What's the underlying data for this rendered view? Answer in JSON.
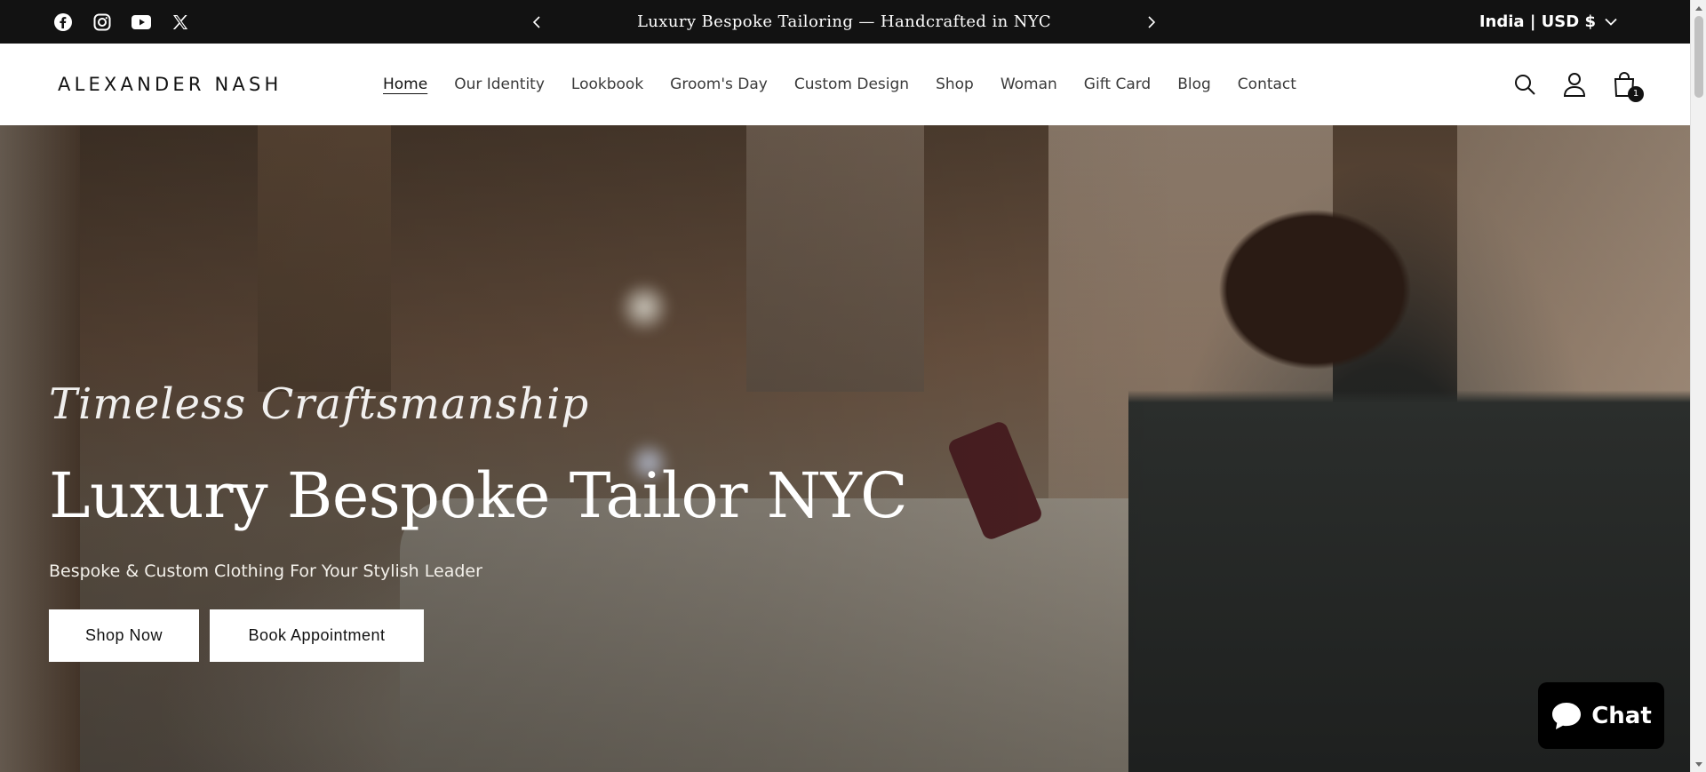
{
  "social": [
    {
      "name": "facebook-icon"
    },
    {
      "name": "instagram-icon"
    },
    {
      "name": "youtube-icon"
    },
    {
      "name": "x-twitter-icon"
    }
  ],
  "announcement": {
    "text": "Luxury Bespoke Tailoring — Handcrafted in NYC"
  },
  "locale": {
    "label": "India | USD $"
  },
  "header": {
    "logo": "ALEXANDER NASH",
    "nav": [
      {
        "label": "Home",
        "active": true
      },
      {
        "label": "Our Identity"
      },
      {
        "label": "Lookbook"
      },
      {
        "label": "Groom's Day"
      },
      {
        "label": "Custom Design"
      },
      {
        "label": "Shop"
      },
      {
        "label": "Woman"
      },
      {
        "label": "Gift Card"
      },
      {
        "label": "Blog"
      },
      {
        "label": "Contact"
      }
    ],
    "cart_count": "1"
  },
  "hero": {
    "tagline": "Timeless Craftsmanship",
    "title": "Luxury Bespoke Tailor NYC",
    "subtitle": "Bespoke & Custom Clothing For Your Stylish Leader",
    "buttons": {
      "shop": "Shop Now",
      "book": "Book Appointment"
    }
  },
  "chat": {
    "label": "Chat"
  },
  "colors": {
    "bar": "#121212",
    "accent": "#ffffff"
  }
}
